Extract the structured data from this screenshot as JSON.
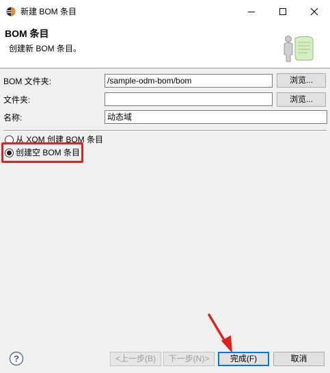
{
  "window": {
    "title": "新建 BOM 条目",
    "icons": {
      "app": "eclipse-icon",
      "minimize": "minimize-icon",
      "maximize": "maximize-icon",
      "close": "close-icon"
    }
  },
  "header": {
    "title": "BOM 条目",
    "description": "创建新 BOM 条目。",
    "icon": "wizard-banner-icon"
  },
  "form": {
    "bom_folder": {
      "label": "BOM 文件夹:",
      "value": "/sample-odm-bom/bom",
      "browse_label": "浏览..."
    },
    "folder": {
      "label": "文件夹:",
      "value": "",
      "browse_label": "浏览..."
    },
    "name": {
      "label": "名称:",
      "value": "动态域"
    }
  },
  "options": [
    {
      "label": "从 XOM 创建 BOM 条目",
      "checked": false
    },
    {
      "label": "创建空 BOM 条目",
      "checked": true
    }
  ],
  "footer": {
    "help_icon": "help-icon",
    "back_label": "<上一步(B)",
    "next_label": "下一步(N)>",
    "finish_label": "完成(F)",
    "cancel_label": "取消"
  },
  "colors": {
    "annotation_red": "#e0201c",
    "focus_blue": "#0078d7"
  }
}
